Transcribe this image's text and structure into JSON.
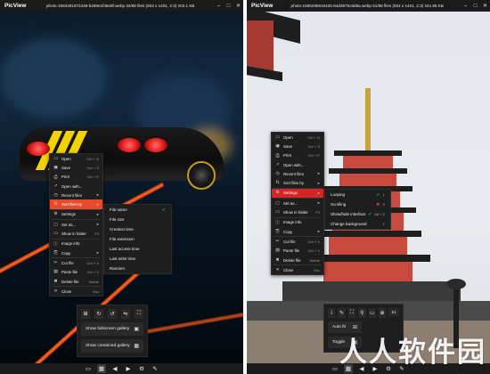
{
  "left": {
    "app_name": "PicView",
    "title": "photo-1593481672449-b299e1f45e8f.webp 34/88 files (934 x 1401, 2:3) 202.1 KB",
    "menu": [
      {
        "icon": "folder-icon",
        "glyph": "▭",
        "label": "Open",
        "shortcut": "Ctrl + O"
      },
      {
        "icon": "save-icon",
        "glyph": "▣",
        "label": "Save",
        "shortcut": "Ctrl + S"
      },
      {
        "icon": "print-icon",
        "glyph": "⎙",
        "label": "Print",
        "shortcut": "Ctrl + P"
      },
      {
        "icon": "open-with-icon",
        "glyph": "↗",
        "label": "Open with...",
        "shortcut": ""
      },
      {
        "icon": "recent-icon",
        "glyph": "◷",
        "label": "Recent files",
        "shortcut": ""
      },
      {
        "icon": "sort-icon",
        "glyph": "⇅",
        "label": "Sort files by",
        "shortcut": "",
        "highlight": true
      },
      {
        "icon": "settings-icon",
        "glyph": "⚙",
        "label": "Settings",
        "shortcut": ""
      },
      {
        "icon": "set-as-icon",
        "glyph": "▢",
        "label": "Set as...",
        "shortcut": ""
      },
      {
        "icon": "folder-icon",
        "glyph": "▭",
        "label": "Show in folder",
        "shortcut": "F3"
      },
      {
        "icon": "info-icon",
        "glyph": "ⓘ",
        "label": "Image info",
        "shortcut": ""
      },
      {
        "icon": "copy-icon",
        "glyph": "⎘",
        "label": "Copy",
        "shortcut": ""
      },
      {
        "icon": "cut-icon",
        "glyph": "✂",
        "label": "Cut file",
        "shortcut": "Ctrl + X"
      },
      {
        "icon": "paste-icon",
        "glyph": "▤",
        "label": "Paste file",
        "shortcut": "Ctrl + V"
      },
      {
        "icon": "delete-icon",
        "glyph": "✖",
        "label": "Delete file",
        "shortcut": "Delete"
      },
      {
        "icon": "close-icon",
        "glyph": "✕",
        "label": "Close",
        "shortcut": "Esc"
      }
    ],
    "submenu": [
      {
        "label": "File name",
        "checked": true
      },
      {
        "label": "File size",
        "checked": false
      },
      {
        "label": "Creation time",
        "checked": false
      },
      {
        "label": "File extension",
        "checked": false
      },
      {
        "label": "Last access time",
        "checked": false
      },
      {
        "label": "Last write time",
        "checked": false
      },
      {
        "label": "Random",
        "checked": false
      }
    ],
    "gallery": {
      "tool_icons": [
        "fit-icon",
        "rotate-right-icon",
        "rotate-left-icon",
        "flip-icon",
        "crop-icon"
      ],
      "tool_glyphs": [
        "⊞",
        "↻",
        "↺",
        "⇋",
        "⛶"
      ],
      "buttons": [
        {
          "label": "Show fullscreen gallery",
          "icon": "gallery-icon",
          "glyph": "▣"
        },
        {
          "label": "Show contained gallery",
          "icon": "gallery-icon",
          "glyph": "▦"
        }
      ]
    },
    "bottom": [
      {
        "icon": "folder-icon",
        "glyph": "▭"
      },
      {
        "icon": "gallery-icon",
        "glyph": "▦",
        "active": true
      },
      {
        "icon": "previous-icon",
        "glyph": "◀"
      },
      {
        "icon": "next-icon",
        "glyph": "▶"
      },
      {
        "icon": "settings-icon",
        "glyph": "⚙"
      },
      {
        "icon": "tools-icon",
        "glyph": "✎"
      }
    ]
  },
  "right": {
    "app_name": "PicView",
    "title": "photo-1595296616425-84d3875c6d6a.webp 51/88 files (934 x 1401, 2:3) 241.95 KB",
    "menu": [
      {
        "icon": "folder-icon",
        "glyph": "▭",
        "label": "Open",
        "shortcut": "Ctrl + O"
      },
      {
        "icon": "save-icon",
        "glyph": "▣",
        "label": "Save",
        "shortcut": "Ctrl + S"
      },
      {
        "icon": "print-icon",
        "glyph": "⎙",
        "label": "Print",
        "shortcut": "Ctrl + P"
      },
      {
        "icon": "open-with-icon",
        "glyph": "↗",
        "label": "Open with...",
        "shortcut": ""
      },
      {
        "icon": "recent-icon",
        "glyph": "◷",
        "label": "Recent files",
        "shortcut": ""
      },
      {
        "icon": "sort-icon",
        "glyph": "⇅",
        "label": "Sort files by",
        "shortcut": ""
      },
      {
        "icon": "settings-icon",
        "glyph": "⚙",
        "label": "Settings",
        "shortcut": "",
        "highlight": true
      },
      {
        "icon": "set-as-icon",
        "glyph": "▢",
        "label": "Set as...",
        "shortcut": ""
      },
      {
        "icon": "folder-icon",
        "glyph": "▭",
        "label": "Show in folder",
        "shortcut": "F3"
      },
      {
        "icon": "info-icon",
        "glyph": "ⓘ",
        "label": "Image info",
        "shortcut": ""
      },
      {
        "icon": "copy-icon",
        "glyph": "⎘",
        "label": "Copy",
        "shortcut": ""
      },
      {
        "icon": "cut-icon",
        "glyph": "✂",
        "label": "Cut file",
        "shortcut": "Ctrl + X"
      },
      {
        "icon": "paste-icon",
        "glyph": "▤",
        "label": "Paste file",
        "shortcut": "Ctrl + V"
      },
      {
        "icon": "delete-icon",
        "glyph": "✖",
        "label": "Delete file",
        "shortcut": "Delete"
      },
      {
        "icon": "close-icon",
        "glyph": "✕",
        "label": "Close",
        "shortcut": "Esc"
      }
    ],
    "submenu": [
      {
        "label": "Looping",
        "state": "check",
        "shortcut": "L"
      },
      {
        "label": "Scrolling",
        "state": "x",
        "shortcut": "X"
      },
      {
        "label": "Show/hide interface",
        "state": "check",
        "shortcut": "Alt + Z"
      },
      {
        "label": "Change background",
        "state": "",
        "shortcut": "T"
      }
    ],
    "toolbar": {
      "tool_icons": [
        "info-icon",
        "pen-icon",
        "crop-icon",
        "search-icon",
        "resize-icon",
        "zoom-icon"
      ],
      "tool_glyphs": [
        "i",
        "✎",
        "⛶",
        "⚲",
        "▭",
        "⊕"
      ],
      "input_value": "51",
      "buttons": [
        {
          "label": "Auto fit",
          "icon": "fit-icon",
          "glyph": "⊞"
        },
        {
          "label": "Toggle",
          "icon": "toggle-icon",
          "glyph": "▣"
        }
      ]
    },
    "bottom": [
      {
        "icon": "folder-icon",
        "glyph": "▭"
      },
      {
        "icon": "gallery-icon",
        "glyph": "▦",
        "active": true
      },
      {
        "icon": "previous-icon",
        "glyph": "◀"
      },
      {
        "icon": "next-icon",
        "glyph": "▶"
      },
      {
        "icon": "settings-icon",
        "glyph": "⚙"
      },
      {
        "icon": "tools-icon",
        "glyph": "✎"
      }
    ]
  },
  "watermark": "人人软件园",
  "colors": {
    "accent_orange": "#e84a2c",
    "accent_red": "#d42424",
    "check_green": "#27b14e"
  }
}
